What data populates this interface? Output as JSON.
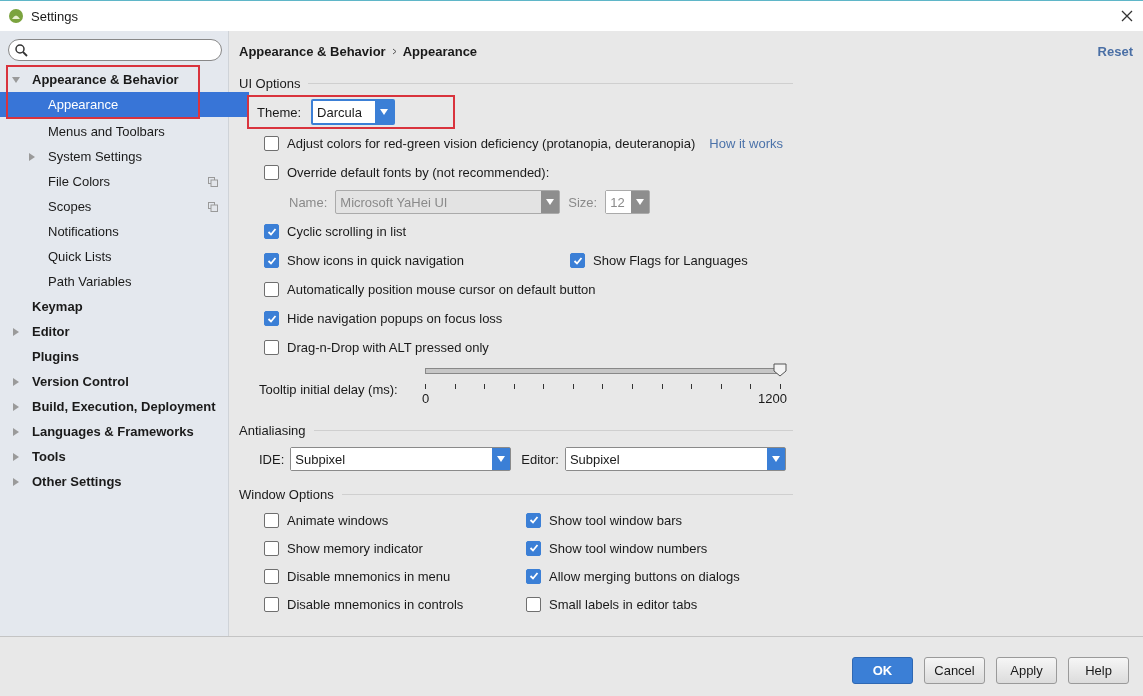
{
  "window": {
    "title": "Settings"
  },
  "tree": [
    {
      "label": "Appearance & Behavior",
      "expanded": true,
      "highlighted": true,
      "selected": false,
      "children": [
        {
          "label": "Appearance",
          "selected": true
        },
        {
          "label": "Menus and Toolbars",
          "selected": false
        },
        {
          "label": "System Settings",
          "expanded": false,
          "selected": false
        },
        {
          "label": "File Colors",
          "project_level": true,
          "selected": false
        },
        {
          "label": "Scopes",
          "project_level": true,
          "selected": false
        },
        {
          "label": "Notifications",
          "selected": false
        },
        {
          "label": "Quick Lists",
          "selected": false
        },
        {
          "label": "Path Variables",
          "selected": false
        }
      ]
    },
    {
      "label": "Keymap",
      "selected": false
    },
    {
      "label": "Editor",
      "expanded": false,
      "selected": false
    },
    {
      "label": "Plugins",
      "selected": false
    },
    {
      "label": "Version Control",
      "expanded": false,
      "selected": false
    },
    {
      "label": "Build, Execution, Deployment",
      "expanded": false,
      "selected": false
    },
    {
      "label": "Languages & Frameworks",
      "expanded": false,
      "selected": false
    },
    {
      "label": "Tools",
      "expanded": false,
      "selected": false
    },
    {
      "label": "Other Settings",
      "expanded": false,
      "selected": false
    }
  ],
  "breadcrumb": [
    "Appearance & Behavior",
    "Appearance"
  ],
  "reset": "Reset",
  "sections": [
    {
      "title": "UI Options",
      "rows": [
        {
          "kind": "select",
          "label": "Theme:",
          "value": "Darcula",
          "highlighted": true
        },
        {
          "kind": "checks",
          "items": [
            {
              "label": "Adjust colors for red-green vision deficiency (protanopia, deuteranopia)",
              "checked": false
            }
          ],
          "link": "How it works"
        },
        {
          "kind": "checks",
          "items": [
            {
              "label": "Override default fonts by (not recommended):",
              "checked": false
            }
          ]
        },
        {
          "kind": "font",
          "name_label": "Name:",
          "name_value": "Microsoft YaHei UI",
          "size_label": "Size:",
          "size_value": "12",
          "disabled": true
        },
        {
          "kind": "checks",
          "items": [
            {
              "label": "Cyclic scrolling in list",
              "checked": true
            }
          ]
        },
        {
          "kind": "checks",
          "items": [
            {
              "label": "Show icons in quick navigation",
              "checked": true
            },
            {
              "label": "Show Flags for Languages",
              "checked": true
            }
          ]
        },
        {
          "kind": "checks",
          "items": [
            {
              "label": "Automatically position mouse cursor on default button",
              "checked": false
            }
          ]
        },
        {
          "kind": "checks",
          "items": [
            {
              "label": "Hide navigation popups on focus loss",
              "checked": true
            }
          ]
        },
        {
          "kind": "checks",
          "items": [
            {
              "label": "Drag-n-Drop with ALT pressed only",
              "checked": false
            }
          ]
        },
        {
          "kind": "slider",
          "label": "Tooltip initial delay (ms):",
          "level": 1,
          "min_label": "0",
          "max_label": "1200"
        }
      ]
    },
    {
      "title": "Antialiasing",
      "rows": [
        {
          "kind": "selects",
          "items": [
            {
              "label": "IDE:",
              "value": "Subpixel"
            },
            {
              "label": "Editor:",
              "value": "Subpixel"
            }
          ]
        }
      ]
    },
    {
      "title": "Window Options",
      "rows": [
        {
          "kind": "grid",
          "items": [
            {
              "label": "Animate windows",
              "checked": false
            },
            {
              "label": "Show tool window bars",
              "checked": true
            },
            {
              "label": "Show memory indicator",
              "checked": false
            },
            {
              "label": "Show tool window numbers",
              "checked": true
            },
            {
              "label": "Disable mnemonics in menu",
              "checked": false
            },
            {
              "label": "Allow merging buttons on dialogs",
              "checked": true
            },
            {
              "label": "Disable mnemonics in controls",
              "checked": false
            },
            {
              "label": "Small labels in editor tabs",
              "checked": false
            }
          ]
        }
      ]
    }
  ],
  "buttons": [
    {
      "label": "OK",
      "default": true
    },
    {
      "label": "Cancel",
      "default": false
    },
    {
      "label": "Apply",
      "default": false
    },
    {
      "label": "Help",
      "default": false
    }
  ]
}
